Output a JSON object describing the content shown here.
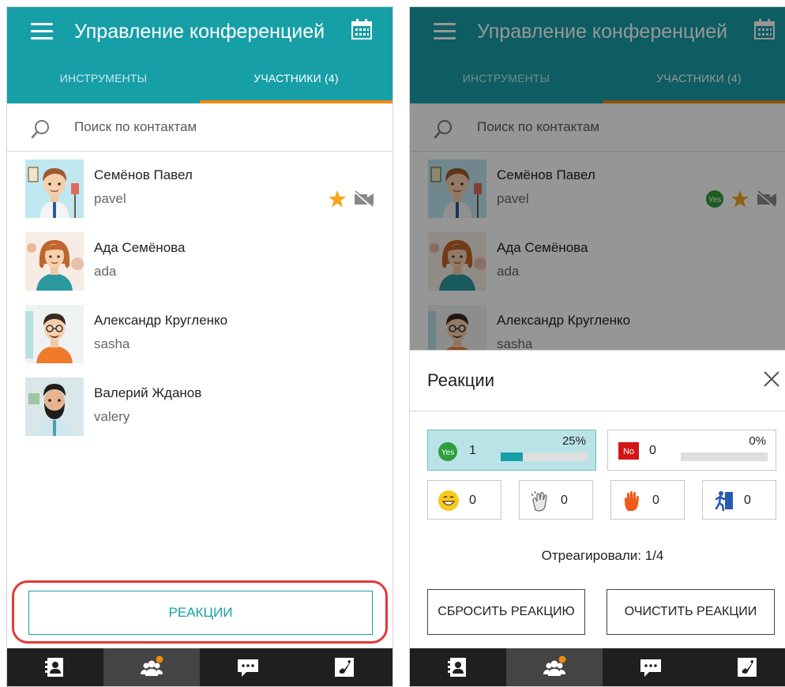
{
  "header": {
    "title": "Управление конференцией",
    "tabs": [
      {
        "label": "ИНСТРУМЕНТЫ"
      },
      {
        "label": "УЧАСТНИКИ (4)"
      }
    ],
    "accent_color": "#179fa8",
    "tab_indicator_color": "#f08a10"
  },
  "search": {
    "placeholder": "Поиск по контактам"
  },
  "contacts": [
    {
      "name": "Семёнов Павел",
      "login": "pavel",
      "badges": [
        "yes-icon",
        "star-icon",
        "video-off-icon"
      ]
    },
    {
      "name": "Ада Семёнова",
      "login": "ada"
    },
    {
      "name": "Александр Кругленко",
      "login": "sasha"
    },
    {
      "name": "Валерий Жданов",
      "login": "valery"
    }
  ],
  "reactions_button": {
    "label": "РЕАКЦИИ"
  },
  "reactions_panel": {
    "title": "Реакции",
    "votes": [
      {
        "badge": "Yes",
        "count": "1",
        "percent": "25%",
        "fraction": 0.25,
        "color": "#2e9e3a",
        "selected": true
      },
      {
        "badge": "No",
        "count": "0",
        "percent": "0%",
        "fraction": 0,
        "color": "#d21616",
        "selected": false
      }
    ],
    "emotions": [
      {
        "icon": "smile-icon",
        "count": "0"
      },
      {
        "icon": "applause-icon",
        "count": "0"
      },
      {
        "icon": "raise-hand-icon",
        "count": "0"
      },
      {
        "icon": "exit-icon",
        "count": "0"
      }
    ],
    "reacted": "Отреагировали: 1/4",
    "reset_button": "СБРОСИТЬ РЕАКЦИЮ",
    "clear_button": "ОЧИСТИТЬ РЕАКЦИИ"
  },
  "bottom_nav": [
    {
      "icon": "contacts-icon"
    },
    {
      "icon": "participants-icon",
      "active": true
    },
    {
      "icon": "chat-icon"
    },
    {
      "icon": "call-icon"
    }
  ]
}
